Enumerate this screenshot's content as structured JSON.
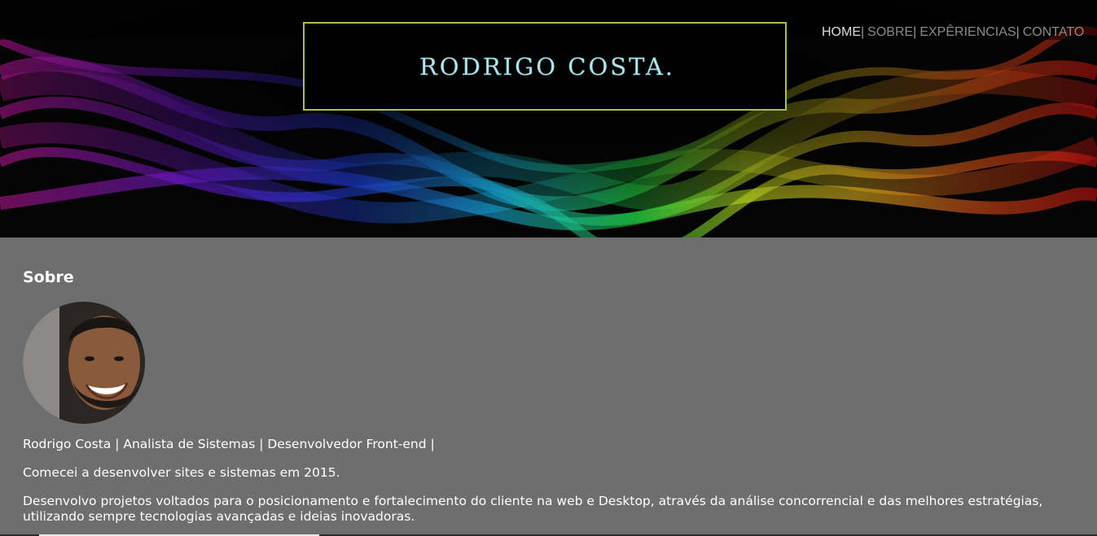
{
  "header": {
    "logo_text": "RODRIGO COSTA.",
    "nav": {
      "home": "HOME",
      "sobre": "SOBRE",
      "experiencias": "EXPÊRIENCIAS",
      "contato": "CONTATO",
      "separator": "|"
    }
  },
  "about": {
    "title": "Sobre",
    "line1": "Rodrigo Costa | Analista de Sistemas | Desenvolvedor Front-end |",
    "line2": "Comecei a desenvolver sites e sistemas em 2015.",
    "line3": "Desenvolvo projetos voltados para o posicionamento e fortalecimento do cliente na web e Desktop, através da análise concorrencial e das melhores estratégias, utilizando sempre tecnologias avançadas e ideias inovadoras."
  },
  "colors": {
    "content_bg": "#6e6e6e",
    "logo_border": "#a9c34a",
    "logo_text": "#b7e3ea",
    "nav_active": "#dcdcdc",
    "nav_inactive": "#8a8a8a"
  }
}
